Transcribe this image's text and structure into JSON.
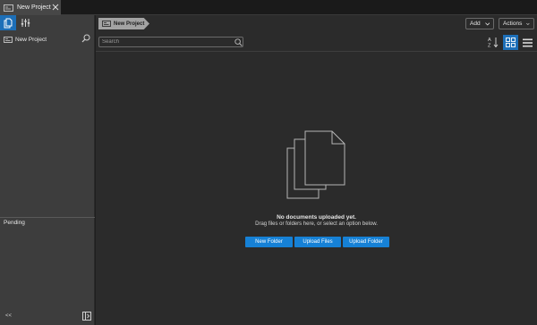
{
  "tab": {
    "label": "New Project"
  },
  "sidebar": {
    "tools": [
      {
        "icon": "documents-icon",
        "active": true
      },
      {
        "icon": "sliders-icon",
        "active": false
      }
    ],
    "project_label": "New Project",
    "pending_label": "Pending",
    "collapse_label": "<<"
  },
  "main": {
    "breadcrumb": "New Project",
    "add_label": "Add",
    "actions_label": "Actions",
    "search_placeholder": "Search",
    "empty_title": "No documents uploaded yet.",
    "empty_subtitle": "Drag files or folders here, or select an option below.",
    "buttons": [
      "New Folder",
      "Upload Files",
      "Upload Folder"
    ]
  },
  "colors": {
    "accent": "#1d6fb8",
    "primary_button": "#1681d6",
    "background": "#2b2b2b",
    "sidebar": "#3d3d3d"
  }
}
